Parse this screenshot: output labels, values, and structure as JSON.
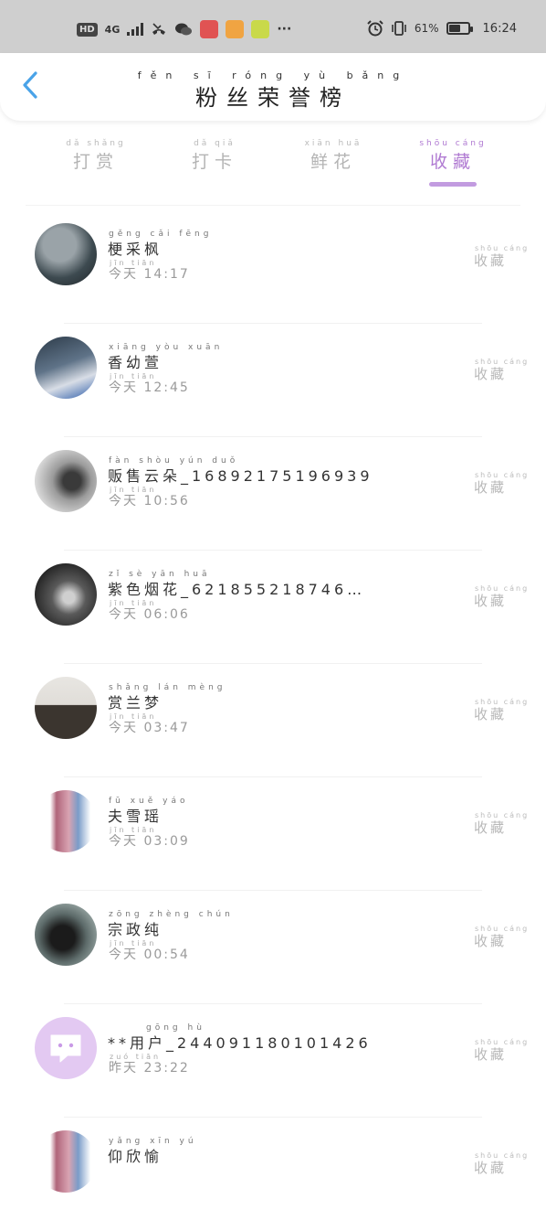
{
  "status_bar": {
    "hd": "HD",
    "net": "4G",
    "battery_pct_text": "61%",
    "battery_level": 0.61,
    "time": "16:24",
    "more": "···"
  },
  "header": {
    "title_pinyin": "fěn sī róng yù bǎng",
    "title": "粉丝荣誉榜"
  },
  "tabs": [
    {
      "pinyin": "dǎ shǎng",
      "label": "打赏",
      "active": false
    },
    {
      "pinyin": "dǎ qiǎ",
      "label": "打卡",
      "active": false
    },
    {
      "pinyin": "xiān huā",
      "label": "鲜花",
      "active": false
    },
    {
      "pinyin": "shōu cáng",
      "label": "收藏",
      "active": true
    }
  ],
  "accent_color": "#b07ad2",
  "list": [
    {
      "name_pinyin": "gěng cǎi fēng",
      "name": "梗采枫",
      "time_pinyin": "jīn tiān",
      "time": "今天 14:17",
      "kind_pinyin": "shōu cáng",
      "kind": "收藏"
    },
    {
      "name_pinyin": "xiāng yòu xuān",
      "name": "香幼萱",
      "time_pinyin": "jīn tiān",
      "time": "今天 12:45",
      "kind_pinyin": "shōu cáng",
      "kind": "收藏"
    },
    {
      "name_pinyin": "fàn shòu yún duǒ",
      "name": "贩售云朵_16892175196939",
      "time_pinyin": "jīn tiān",
      "time": "今天 10:56",
      "kind_pinyin": "shōu cáng",
      "kind": "收藏"
    },
    {
      "name_pinyin": "zǐ sè yān huā",
      "name": "紫色烟花_621855218746…",
      "time_pinyin": "jīn tiān",
      "time": "今天 06:06",
      "kind_pinyin": "shōu cáng",
      "kind": "收藏"
    },
    {
      "name_pinyin": "shǎng lán mèng",
      "name": "赏兰梦",
      "time_pinyin": "jīn tiān",
      "time": "今天 03:47",
      "kind_pinyin": "shōu cáng",
      "kind": "收藏"
    },
    {
      "name_pinyin": "fū xuě yáo",
      "name": "夫雪瑶",
      "time_pinyin": "jīn tiān",
      "time": "今天 03:09",
      "kind_pinyin": "shōu cáng",
      "kind": "收藏"
    },
    {
      "name_pinyin": "zōng zhèng chún",
      "name": "宗政纯",
      "time_pinyin": "jīn tiān",
      "time": "今天 00:54",
      "kind_pinyin": "shōu cáng",
      "kind": "收藏"
    },
    {
      "name_pinyin": "gōng hù",
      "name": "**用户_244091180101426",
      "time_pinyin": "zuó tiān",
      "time": "昨天 23:22",
      "kind_pinyin": "shōu cáng",
      "kind": "收藏"
    },
    {
      "name_pinyin": "yǎng xīn yú",
      "name": "仰欣愉",
      "time_pinyin": "",
      "time": "",
      "kind_pinyin": "shōu cáng",
      "kind": "收藏"
    }
  ]
}
